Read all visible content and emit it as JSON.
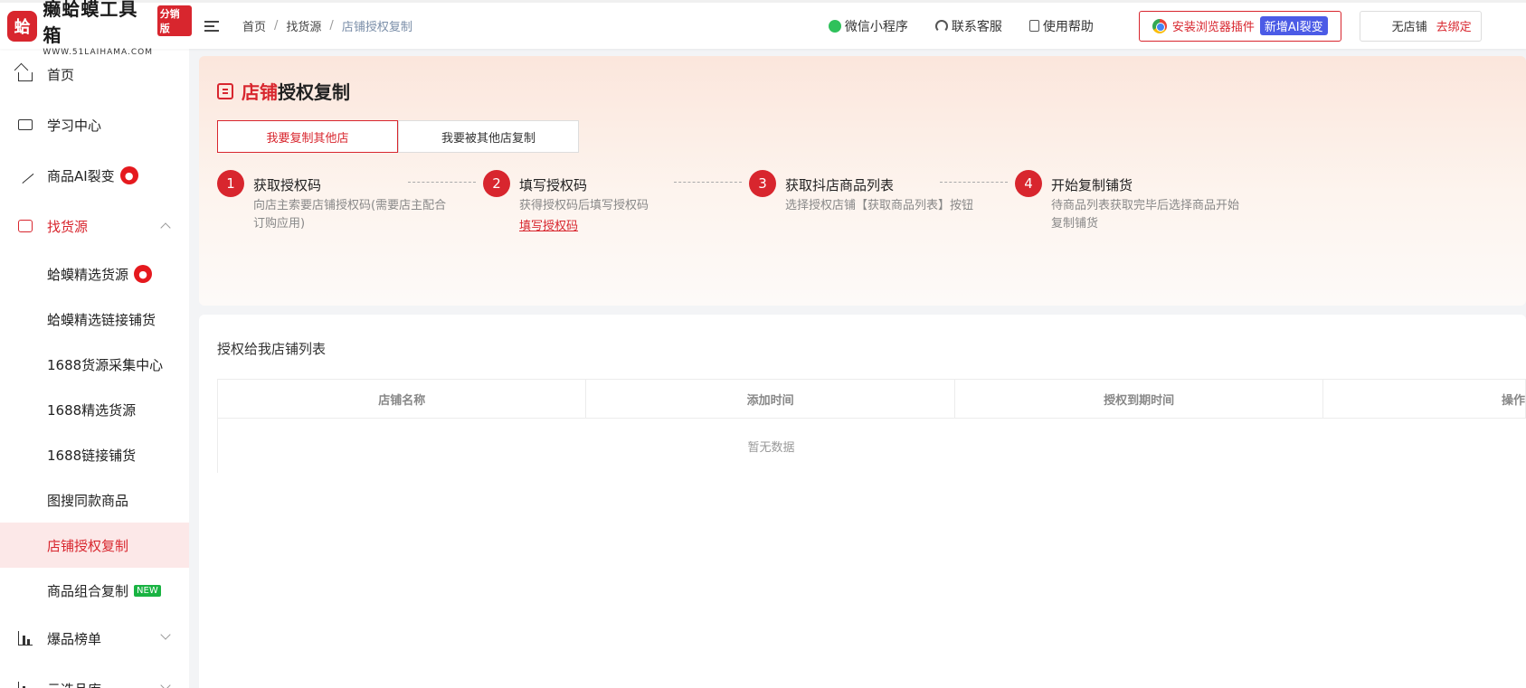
{
  "header": {
    "logo_title": "癞蛤蟆工具箱",
    "logo_edition": "分销版",
    "logo_url": "WWW.51LAIHAMA.COM",
    "breadcrumb": [
      "首页",
      "找货源",
      "店铺授权复制"
    ],
    "links": {
      "mini_program": "微信小程序",
      "customer_service": "联系客服",
      "help": "使用帮助"
    },
    "extension_button": {
      "label": "安装浏览器插件",
      "badge": "新增AI裂变"
    },
    "bind": {
      "status": "无店铺",
      "action": "去绑定"
    }
  },
  "sidebar": {
    "items": [
      {
        "label": "首页",
        "icon": "home-icon"
      },
      {
        "label": "学习中心",
        "icon": "book-icon"
      },
      {
        "label": "商品AI裂变",
        "icon": "ai-wand-icon",
        "badge": "fire"
      },
      {
        "label": "找货源",
        "icon": "source-icon",
        "expanded": true
      }
    ],
    "sub_items": [
      {
        "label": "蛤蟆精选货源",
        "badge": "fire"
      },
      {
        "label": "蛤蟆精选链接铺货"
      },
      {
        "label": "1688货源采集中心"
      },
      {
        "label": "1688精选货源"
      },
      {
        "label": "1688链接铺货"
      },
      {
        "label": "图搜同款商品"
      },
      {
        "label": "店铺授权复制",
        "active": true
      },
      {
        "label": "商品组合复制",
        "badge": "NEW"
      }
    ],
    "bottom_items": [
      {
        "label": "爆品榜单",
        "icon": "ranking-icon"
      },
      {
        "label": "云选品库"
      }
    ]
  },
  "page": {
    "heading_red": "店铺",
    "heading_rest": "授权复制",
    "tabs": [
      "我要复制其他店",
      "我要被其他店复制"
    ],
    "steps": [
      {
        "num": "1",
        "title": "获取授权码",
        "desc": "向店主索要店铺授权码(需要店主配合订购应用)"
      },
      {
        "num": "2",
        "title": "填写授权码",
        "desc": "获得授权码后填写授权码",
        "link": "填写授权码"
      },
      {
        "num": "3",
        "title": "获取抖店商品列表",
        "desc": "选择授权店铺【获取商品列表】按钮"
      },
      {
        "num": "4",
        "title": "开始复制铺货",
        "desc": "待商品列表获取完毕后选择商品开始复制铺货"
      }
    ],
    "list": {
      "title": "授权给我店铺列表",
      "columns": [
        "店铺名称",
        "添加时间",
        "授权到期时间",
        "操作"
      ],
      "empty_text": "暂无数据"
    }
  },
  "colors": {
    "brand_red": "#d8262e",
    "new_badge": "#19b342",
    "ai_badge": "#4b5be6"
  }
}
